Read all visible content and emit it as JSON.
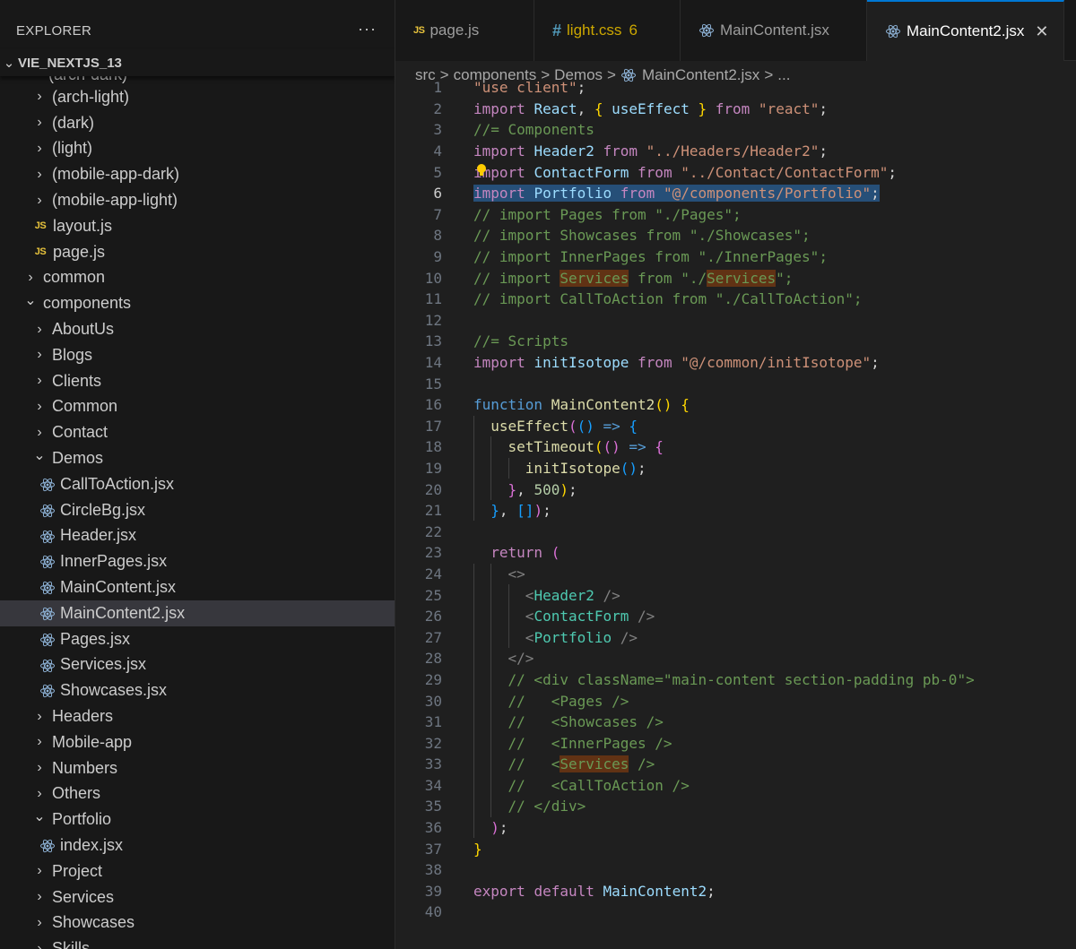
{
  "sidebar": {
    "title": "EXPLORER",
    "more_label": "···",
    "project": "VIE_NEXTJS_13",
    "truncated_item": "(arch-dark)",
    "items": [
      {
        "label": "(arch-light)",
        "kind": "folder",
        "state": "collapsed",
        "depth": 1
      },
      {
        "label": "(dark)",
        "kind": "folder",
        "state": "collapsed",
        "depth": 1
      },
      {
        "label": "(light)",
        "kind": "folder",
        "state": "collapsed",
        "depth": 1
      },
      {
        "label": "(mobile-app-dark)",
        "kind": "folder",
        "state": "collapsed",
        "depth": 1
      },
      {
        "label": "(mobile-app-light)",
        "kind": "folder",
        "state": "collapsed",
        "depth": 1
      },
      {
        "label": "layout.js",
        "kind": "js",
        "depth": 1
      },
      {
        "label": "page.js",
        "kind": "js",
        "depth": 1
      },
      {
        "label": "common",
        "kind": "folder",
        "state": "collapsed",
        "depth": 0
      },
      {
        "label": "components",
        "kind": "folder",
        "state": "expanded",
        "depth": 0
      },
      {
        "label": "AboutUs",
        "kind": "folder",
        "state": "collapsed",
        "depth": 1
      },
      {
        "label": "Blogs",
        "kind": "folder",
        "state": "collapsed",
        "depth": 1
      },
      {
        "label": "Clients",
        "kind": "folder",
        "state": "collapsed",
        "depth": 1
      },
      {
        "label": "Common",
        "kind": "folder",
        "state": "collapsed",
        "depth": 1
      },
      {
        "label": "Contact",
        "kind": "folder",
        "state": "collapsed",
        "depth": 1
      },
      {
        "label": "Demos",
        "kind": "folder",
        "state": "expanded",
        "depth": 1
      },
      {
        "label": "CallToAction.jsx",
        "kind": "jsx",
        "depth": 2
      },
      {
        "label": "CircleBg.jsx",
        "kind": "jsx",
        "depth": 2
      },
      {
        "label": "Header.jsx",
        "kind": "jsx",
        "depth": 2
      },
      {
        "label": "InnerPages.jsx",
        "kind": "jsx",
        "depth": 2
      },
      {
        "label": "MainContent.jsx",
        "kind": "jsx",
        "depth": 2
      },
      {
        "label": "MainContent2.jsx",
        "kind": "jsx",
        "depth": 2,
        "active": true
      },
      {
        "label": "Pages.jsx",
        "kind": "jsx",
        "depth": 2
      },
      {
        "label": "Services.jsx",
        "kind": "jsx",
        "depth": 2
      },
      {
        "label": "Showcases.jsx",
        "kind": "jsx",
        "depth": 2
      },
      {
        "label": "Headers",
        "kind": "folder",
        "state": "collapsed",
        "depth": 1
      },
      {
        "label": "Mobile-app",
        "kind": "folder",
        "state": "collapsed",
        "depth": 1
      },
      {
        "label": "Numbers",
        "kind": "folder",
        "state": "collapsed",
        "depth": 1
      },
      {
        "label": "Others",
        "kind": "folder",
        "state": "collapsed",
        "depth": 1
      },
      {
        "label": "Portfolio",
        "kind": "folder",
        "state": "expanded",
        "depth": 1
      },
      {
        "label": "index.jsx",
        "kind": "jsx",
        "depth": 2
      },
      {
        "label": "Project",
        "kind": "folder",
        "state": "collapsed",
        "depth": 1
      },
      {
        "label": "Services",
        "kind": "folder",
        "state": "collapsed",
        "depth": 1
      },
      {
        "label": "Showcases",
        "kind": "folder",
        "state": "collapsed",
        "depth": 1
      },
      {
        "label": "Skills",
        "kind": "folder",
        "state": "collapsed",
        "depth": 1
      }
    ]
  },
  "tabs": [
    {
      "label": "page.js",
      "icon": "js",
      "icon_text": "JS",
      "width": 155
    },
    {
      "label": "light.css",
      "icon": "css",
      "icon_text": "#",
      "badge": "6",
      "modified": true,
      "width": 163
    },
    {
      "label": "MainContent.jsx",
      "icon": "react",
      "width": 208
    },
    {
      "label": "MainContent2.jsx",
      "icon": "react",
      "active": true,
      "close": "✕",
      "width": 220
    }
  ],
  "breadcrumb": {
    "parts": [
      "src",
      "components",
      "Demos",
      "MainContent2.jsx",
      "..."
    ],
    "separator": ">"
  },
  "editor": {
    "active_line": 6,
    "lines": [
      [
        [
          "str",
          "\"use client\""
        ],
        [
          "plain",
          ";"
        ]
      ],
      [
        [
          "kw",
          "import "
        ],
        [
          "id",
          "React"
        ],
        [
          "plain",
          ", "
        ],
        [
          "br1",
          "{"
        ],
        [
          "id",
          " useEffect "
        ],
        [
          "br1",
          "}"
        ],
        [
          "kw",
          " from "
        ],
        [
          "str",
          "\"react\""
        ],
        [
          "plain",
          ";"
        ]
      ],
      [
        [
          "cm",
          "//= Components"
        ]
      ],
      [
        [
          "kw",
          "import "
        ],
        [
          "id",
          "Header2"
        ],
        [
          "kw",
          " from "
        ],
        [
          "str",
          "\"../Headers/Header2\""
        ],
        [
          "plain",
          ";"
        ]
      ],
      [
        [
          "kw",
          "import "
        ],
        [
          "id",
          "ContactForm"
        ],
        [
          "kw",
          " from "
        ],
        [
          "str",
          "\"../Contact/ContactForm\""
        ],
        [
          "plain",
          ";"
        ]
      ],
      [
        [
          "kw sel",
          "import"
        ],
        [
          "plain sel",
          " "
        ],
        [
          "id sel",
          "Portfolio"
        ],
        [
          "plain sel",
          " "
        ],
        [
          "kw sel",
          "from"
        ],
        [
          "plain sel",
          " "
        ],
        [
          "str sel",
          "\"@/components/Portfolio\""
        ],
        [
          "plain sel",
          ";"
        ]
      ],
      [
        [
          "cm",
          "// import Pages from \"./Pages\";"
        ]
      ],
      [
        [
          "cm",
          "// import Showcases from \"./Showcases\";"
        ]
      ],
      [
        [
          "cm",
          "// import InnerPages from \"./InnerPages\";"
        ]
      ],
      [
        [
          "cm",
          "// import "
        ],
        [
          "cm hl-find",
          "Services"
        ],
        [
          "cm",
          " from \"./"
        ],
        [
          "cm hl-find",
          "Services"
        ],
        [
          "cm",
          "\";"
        ]
      ],
      [
        [
          "cm",
          "// import CallToAction from \"./CallToAction\";"
        ]
      ],
      [],
      [
        [
          "cm",
          "//= Scripts"
        ]
      ],
      [
        [
          "kw",
          "import "
        ],
        [
          "id",
          "initIsotope"
        ],
        [
          "kw",
          " from "
        ],
        [
          "str",
          "\"@/common/initIsotope\""
        ],
        [
          "plain",
          ";"
        ]
      ],
      [],
      [
        [
          "kw2",
          "function "
        ],
        [
          "fn",
          "MainContent2"
        ],
        [
          "br1",
          "()"
        ],
        [
          "plain",
          " "
        ],
        [
          "br1",
          "{"
        ]
      ],
      [
        [
          "plain",
          "  "
        ],
        [
          "fn",
          "useEffect"
        ],
        [
          "br2",
          "("
        ],
        [
          "br3",
          "()"
        ],
        [
          "kw2",
          " => "
        ],
        [
          "br3",
          "{"
        ]
      ],
      [
        [
          "plain",
          "    "
        ],
        [
          "fn",
          "setTimeout"
        ],
        [
          "br1",
          "("
        ],
        [
          "br2",
          "()"
        ],
        [
          "kw2",
          " => "
        ],
        [
          "br2",
          "{"
        ]
      ],
      [
        [
          "plain",
          "      "
        ],
        [
          "fn",
          "initIsotope"
        ],
        [
          "br3",
          "()"
        ],
        [
          "plain",
          ";"
        ]
      ],
      [
        [
          "plain",
          "    "
        ],
        [
          "br2",
          "}"
        ],
        [
          "plain",
          ", "
        ],
        [
          "num",
          "500"
        ],
        [
          "br1",
          ")"
        ],
        [
          "plain",
          ";"
        ]
      ],
      [
        [
          "plain",
          "  "
        ],
        [
          "br3",
          "}"
        ],
        [
          "plain",
          ", "
        ],
        [
          "br3",
          "[]"
        ],
        [
          "br2",
          ")"
        ],
        [
          "plain",
          ";"
        ]
      ],
      [],
      [
        [
          "plain",
          "  "
        ],
        [
          "kw",
          "return "
        ],
        [
          "br2",
          "("
        ]
      ],
      [
        [
          "plain",
          "    "
        ],
        [
          "ang",
          "<>"
        ]
      ],
      [
        [
          "plain",
          "      "
        ],
        [
          "ang",
          "<"
        ],
        [
          "tag",
          "Header2"
        ],
        [
          "ang",
          " />"
        ]
      ],
      [
        [
          "plain",
          "      "
        ],
        [
          "ang",
          "<"
        ],
        [
          "tag",
          "ContactForm"
        ],
        [
          "ang",
          " />"
        ]
      ],
      [
        [
          "plain",
          "      "
        ],
        [
          "ang",
          "<"
        ],
        [
          "tag",
          "Portfolio"
        ],
        [
          "ang",
          " />"
        ]
      ],
      [
        [
          "plain",
          "    "
        ],
        [
          "ang",
          "</>"
        ]
      ],
      [
        [
          "plain",
          "    "
        ],
        [
          "cm",
          "// <div className=\"main-content section-padding pb-0\">"
        ]
      ],
      [
        [
          "plain",
          "    "
        ],
        [
          "cm",
          "//   <Pages />"
        ]
      ],
      [
        [
          "plain",
          "    "
        ],
        [
          "cm",
          "//   <Showcases />"
        ]
      ],
      [
        [
          "plain",
          "    "
        ],
        [
          "cm",
          "//   <InnerPages />"
        ]
      ],
      [
        [
          "plain",
          "    "
        ],
        [
          "cm",
          "//   <"
        ],
        [
          "cm hl-find",
          "Services"
        ],
        [
          "cm",
          " />"
        ]
      ],
      [
        [
          "plain",
          "    "
        ],
        [
          "cm",
          "//   <CallToAction />"
        ]
      ],
      [
        [
          "plain",
          "    "
        ],
        [
          "cm",
          "// </div>"
        ]
      ],
      [
        [
          "plain",
          "  "
        ],
        [
          "br2",
          ")"
        ],
        [
          "plain",
          ";"
        ]
      ],
      [
        [
          "br1",
          "}"
        ]
      ],
      [],
      [
        [
          "kw",
          "export "
        ],
        [
          "kw",
          "default "
        ],
        [
          "id",
          "MainContent2"
        ],
        [
          "plain",
          ";"
        ]
      ],
      []
    ]
  },
  "colors": {
    "sidebar_bg": "#181818",
    "editor_bg": "#1f1f1f",
    "active_tab_border": "#0078d4",
    "selection": "#264f78",
    "find_highlight": "#613214",
    "react_icon": "#8fb4d8",
    "js_icon": "#e8c33c",
    "css_icon": "#519aba"
  }
}
